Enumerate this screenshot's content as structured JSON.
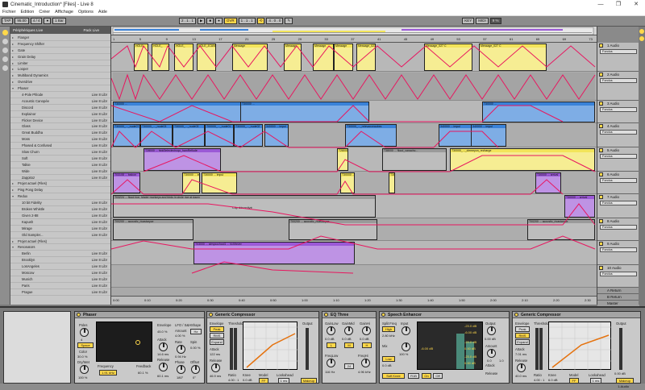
{
  "window": {
    "title": "Cinematic_Introduction* [Files] - Live 8",
    "controls": [
      "—",
      "❐",
      "✕"
    ]
  },
  "menu": [
    "Fichier",
    "Edition",
    "Créer",
    "Affichage",
    "Options",
    "Aide"
  ],
  "transport": {
    "tap": "TAP",
    "tempo": "95.00",
    "sig": "4 / 4",
    "quant": "1 Bar",
    "pos": "2 . 1 . 1",
    "loop_start": "1 . 1 . 1",
    "loop_len": "4 . 0 . 0",
    "key": "KEY",
    "midi": "MIDI",
    "cpu": "9 %",
    "ovr": "OVR"
  },
  "browser": {
    "title": "Périphériques Live",
    "col2": "Pack Live",
    "items": [
      {
        "label": "Flanger",
        "status": "",
        "type": "folder"
      },
      {
        "label": "Frequency Shifter",
        "status": "",
        "type": "folder"
      },
      {
        "label": "Gate",
        "status": "",
        "type": "folder"
      },
      {
        "label": "Grain Delay",
        "status": "",
        "type": "folder"
      },
      {
        "label": "Limiter",
        "status": "",
        "type": "folder"
      },
      {
        "label": "Looper",
        "status": "",
        "type": "folder"
      },
      {
        "label": "Multiband Dynamics",
        "status": "",
        "type": "folder"
      },
      {
        "label": "Overdrive",
        "status": "",
        "type": "folder"
      },
      {
        "label": "Phaser",
        "status": "",
        "type": "open"
      },
      {
        "label": "4-Pole Phlode",
        "status": "Live 8 Libr",
        "type": "preset"
      },
      {
        "label": "Acoustic Canopée",
        "status": "Live 8 Libr",
        "type": "preset"
      },
      {
        "label": "Discord",
        "status": "Live 8 Libr",
        "type": "preset"
      },
      {
        "label": "Explainor",
        "status": "Live 8 Libr",
        "type": "preset"
      },
      {
        "label": "Flicker Device",
        "status": "Live 8 Libr",
        "type": "preset"
      },
      {
        "label": "Glass",
        "status": "Live 8 Libr",
        "type": "preset"
      },
      {
        "label": "Great Buddha",
        "status": "Live 8 Libr",
        "type": "preset"
      },
      {
        "label": "Moss",
        "status": "Live 8 Libr",
        "type": "preset"
      },
      {
        "label": "Phased & Confused",
        "status": "Live 8 Libr",
        "type": "preset"
      },
      {
        "label": "Slow Churn",
        "status": "Live 8 Libr",
        "type": "preset"
      },
      {
        "label": "Soft",
        "status": "Live 8 Libr",
        "type": "preset"
      },
      {
        "label": "Talkie",
        "status": "Live 8 Libr",
        "type": "preset"
      },
      {
        "label": "Wide",
        "status": "Live 8 Libr",
        "type": "preset"
      },
      {
        "label": "Zappitoz",
        "status": "Live 8 Libr",
        "type": "preset"
      },
      {
        "label": "Projet actuel (Files)",
        "status": "",
        "type": "folder"
      },
      {
        "label": "Ping Pong Delay",
        "status": "",
        "type": "folder"
      },
      {
        "label": "Redux",
        "status": "",
        "type": "open"
      },
      {
        "label": "10 bit Fidelity",
        "status": "Live 8 Libr",
        "type": "preset"
      },
      {
        "label": "Broken Whistle",
        "status": "Live 8 Libr",
        "type": "preset"
      },
      {
        "label": "Given 2-88",
        "status": "Live 8 Libr",
        "type": "preset"
      },
      {
        "label": "Kapush",
        "status": "Live 8 Libr",
        "type": "preset"
      },
      {
        "label": "Mirage",
        "status": "Live 8 Libr",
        "type": "preset"
      },
      {
        "label": "Old Sampler...",
        "status": "Live 8 Libr",
        "type": "preset"
      },
      {
        "label": "Projet actuel (Files)",
        "status": "",
        "type": "folder"
      },
      {
        "label": "Resonators",
        "status": "",
        "type": "open"
      },
      {
        "label": "Berlin",
        "status": "Live 8 Libr",
        "type": "preset"
      },
      {
        "label": "Brooklyn",
        "status": "Live 8 Libr",
        "type": "preset"
      },
      {
        "label": "LosAngeles",
        "status": "Live 8 Libr",
        "type": "preset"
      },
      {
        "label": "Moscow",
        "status": "Live 8 Libr",
        "type": "preset"
      },
      {
        "label": "Munich",
        "status": "Live 8 Libr",
        "type": "preset"
      },
      {
        "label": "Paris",
        "status": "Live 8 Libr",
        "type": "preset"
      },
      {
        "label": "Prague",
        "status": "Live 8 Libr",
        "type": "preset"
      }
    ]
  },
  "ruler": [
    "1",
    "5",
    "9",
    "13",
    "17",
    "21",
    "25",
    "29",
    "33",
    "37",
    "41",
    "45",
    "49",
    "53",
    "57",
    "61",
    "65",
    "69",
    "73"
  ],
  "timeline": [
    "0:00",
    "0:10",
    "0:20",
    "0:30",
    "0:40",
    "0:50",
    "1:00",
    "1:10",
    "1:20",
    "1:30",
    "1:40",
    "1:50",
    "2:00",
    "2:10",
    "2:20",
    "2:30"
  ],
  "tracks": [
    {
      "name": "1 Audio",
      "input": "Fondus"
    },
    {
      "name": "2 Audio",
      "input": "Fondus"
    },
    {
      "name": "3 Audio",
      "input": "Fondus"
    },
    {
      "name": "4 Audio",
      "input": "Fondus"
    },
    {
      "name": "5 Audio",
      "input": "Fondus"
    },
    {
      "name": "6 Audio",
      "input": "Fondus"
    },
    {
      "name": "7 Audio",
      "input": "Fondus"
    },
    {
      "name": "8 Audio",
      "input": "Fondus"
    },
    {
      "name": "9 Audio",
      "input": "Fondus"
    },
    {
      "name": "10 Audio",
      "input": "Fondus"
    }
  ],
  "returns": [
    "A Return",
    "B Return",
    "Master"
  ],
  "clips": {
    "t1": [
      "HOLE_",
      "HOLE_",
      "HOLE_",
      "HOLE_JCANNA",
      "Message",
      "Message",
      "Message",
      "Message",
      "Message_027 A",
      "Message_027 C"
    ],
    "t3": [
      "T30000 ... ",
      "T30000 ... "
    ],
    "t4": [
      "T30000_..._nude07",
      "T30000_..._nude03",
      "T30000_..._nude03",
      "T00000_..._nude01",
      "T30000_..._nude02",
      "340000 ... impul",
      "T30000_..._relevanceaubes",
      "340000 ... impul",
      "340000 ... impul"
    ],
    "t5": [
      "T28000 ... hidd3eleclechoqu_hamReflude",
      "T28000_..._dans",
      "T38000 ... flood_vanacho...",
      "T30000_..._clemeyon_recharge"
    ],
    "t6": [
      "T03108 ... balcon",
      "T30000 ... impul",
      "T30000 ... impul",
      "T30000 ... impul",
      "T30000 ... impul",
      "T30000 ... arrival"
    ],
    "t7": [
      "T03224 ... flood rice, hinder monkeys and birds in circle rice at dawn",
      "Clip désactivé",
      "T30000 ... arrival"
    ],
    "t8": [
      "T00200 ... acoustic_ricastaryce",
      "T00200 ... acoustic_ricastaryce",
      "T00200 ... acoustic_ricastaryce"
    ],
    "t9": [
      "T03000 ... atmysochool1 ... richfrever"
    ]
  },
  "devices": {
    "phaser": {
      "title": "Phaser",
      "labels": {
        "poles": "Poles",
        "color": "Color",
        "drywet": "Dry/Wet",
        "freq": "Frequency",
        "feedback": "Feedback",
        "env": "Envelope",
        "lfo": "LFO / S&H",
        "amount": "Amount",
        "shape": "Shape",
        "rate": "Rate",
        "attack": "Attack",
        "release": "Release",
        "phase": "Phase",
        "offset": "Offset",
        "spin": "Spin"
      },
      "values": {
        "poles": "4",
        "mode": "Space",
        "color": "30.0 %",
        "drywet": "100 %",
        "freq": "1.91 kHz",
        "feedback": "60.1 %",
        "env": "45.0 %",
        "amount": "4.00 %",
        "rate": "0.94 Hz",
        "attack": "14.6 ms",
        "release": "60.1 ms",
        "phase": "180°",
        "offset": "0°",
        "spin": "0.00 %",
        "rel2": "40.0 %",
        "h": "Hz"
      }
    },
    "comp1": {
      "title": "Generic Compressor",
      "labels": {
        "threshold": "Threshold",
        "gr": "GR",
        "output": "Output",
        "ratio": "Ratio",
        "attack": "Attack",
        "release": "Release",
        "knee": "Knee",
        "model": "Model",
        "lookahead": "Lookahead",
        "envelope": "Envelope"
      },
      "values": {
        "threshold": "-16.7 dB",
        "ratio": "4.00 : 1",
        "attack": "2.50 ms",
        "release": "122 ms",
        "out": "0.00 dB",
        "envmode": "Peak",
        "rms": "RMS",
        "expand": "Expand",
        "lin": "Lin",
        "log": "Log",
        "knee": "0.0 dB",
        "lookahead": "1 ms",
        "makeup": "Makeup",
        "model": "FF",
        "release2": "46.9 ms"
      }
    },
    "eq": {
      "title": "EQ Three",
      "labels": {
        "gainlow": "GainLow",
        "gainmid": "GainMid",
        "gainhi": "GainHi",
        "freqlow": "FreqLow",
        "freqhi": "FreqHi"
      },
      "values": {
        "gainlow": "0.0 dB",
        "gainmid": "0.0 dB",
        "gainhi": "0.0 dB",
        "freqlow": "116 Hz",
        "freqhi": "4.96 kHz",
        "l": "L",
        "m": "M",
        "h": "H",
        "slope": "24"
      }
    },
    "speech": {
      "title": "Speech Enhancer",
      "labels": {
        "splitfreq": "Split Freq",
        "input": "Input",
        "high": "High",
        "low": "Low",
        "mix": "Mix",
        "output": "Output",
        "amount": "Amount",
        "attack": "Attack",
        "release": "Release",
        "threshold": "Threshold",
        "gain": "Gain"
      },
      "values": {
        "high": "High",
        "low": "Low",
        "highval": "2.80 kHz",
        "lowval": "0.0 dB",
        "mix": "100 %",
        "output": "0.00 dB",
        "m1": "-23.0 dB",
        "m2": "-23.0 dB",
        "m3": "-23.0 dB",
        "m4": "-6.00 dB",
        "m5": "-6.00 dB",
        "m6": "0.00 dB",
        "m7": "0.00 dB",
        "soft": "Soft Knee",
        "r1": "R1B",
        "on": "On",
        "off": "Off",
        "amount": "0.0",
        "ratio": "1.0"
      }
    },
    "comp2": {
      "title": "Generic Compressor",
      "labels": {
        "threshold": "Threshold",
        "output": "Output",
        "ratio": "Ratio",
        "attack": "Attack",
        "release": "Release",
        "knee": "Knee",
        "model": "Model",
        "lookahead": "Lookahead",
        "envelope": "Envelope"
      },
      "values": {
        "threshold": "-21.0 dB",
        "ratio": "4.00 : 1",
        "attack": "7.01 ms",
        "release": "40.0 ms",
        "out": "0.00 dB",
        "rms": "RMS",
        "lin": "Lin",
        "log": "Log",
        "knee": "6.0 dB",
        "lookahead": "1 ms",
        "model": "FF",
        "peak": "Peak",
        "expand": "Expand",
        "makeup": "Makeup"
      }
    }
  },
  "status": {
    "left": "",
    "right": "1-Audio"
  },
  "colors": {
    "accent": "#ffd84a",
    "envelope": "#e8155f",
    "clip_blue": "#3a82d8",
    "clip_yellow": "#f2e45a",
    "clip_purple": "#9b59d6",
    "clip_gray": "#9a9a9a"
  }
}
